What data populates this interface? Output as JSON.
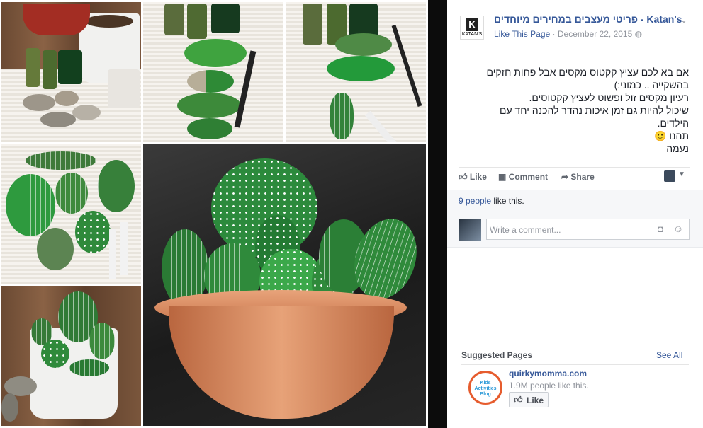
{
  "post": {
    "page_name": "פריטי מעצבים במחירים מיוחדים - Katan's",
    "like_page": "Like This Page",
    "date": "December 22, 2015",
    "logo_text": "KATAN'S",
    "text_lines": [
      "אם בא לכם עציץ קקטוס מקסים אבל פחות חזקים",
      "בהשקייה .. כמוני:)",
      "רעיון מקסים זול ופשוט לעציץ קקטוסים.",
      "שיכול להיות גם זמן איכות נהדר להכנה יחד עם",
      "הילדים.",
      "תהנו 🙂",
      "נעמה"
    ]
  },
  "actions": {
    "like": "Like",
    "comment": "Comment",
    "share": "Share"
  },
  "likes": {
    "count": "9 people",
    "suffix": "like this."
  },
  "comment": {
    "placeholder": "Write a comment..."
  },
  "suggested": {
    "title": "Suggested Pages",
    "see_all": "See All",
    "page_name": "quirkymomma.com",
    "likes": "1.9M people like this.",
    "like_button": "Like",
    "logo_text": "Kids Activities Blog"
  },
  "colors": {
    "link": "#365899",
    "green": "#2f8a3b"
  }
}
